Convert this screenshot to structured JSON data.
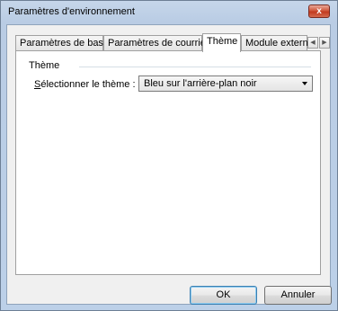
{
  "window": {
    "title": "Paramètres d'environnement",
    "close_label": "x"
  },
  "tabs": [
    {
      "label": "Paramètres de base"
    },
    {
      "label": "Paramètres de courriel"
    },
    {
      "label": "Thème"
    },
    {
      "label": "Module externe"
    }
  ],
  "active_tab": "Thème",
  "theme_group": {
    "label": "Thème",
    "field_label_underlined": "S",
    "field_label_rest": "électionner le thème :",
    "selected_value": "Bleu sur l'arrière-plan noir"
  },
  "buttons": {
    "ok": "OK",
    "cancel": "Annuler"
  },
  "colors": {
    "close_button": "#c23a1f",
    "title_bar": "#b9cce4"
  }
}
